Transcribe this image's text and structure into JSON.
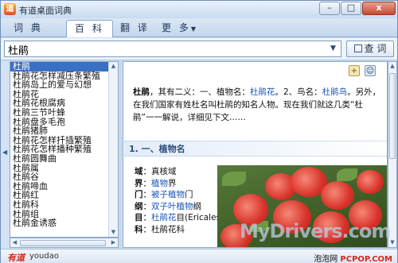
{
  "window": {
    "title": "有道桌面词典",
    "min_label": "–",
    "max_label": "□",
    "close_label": "x"
  },
  "tabs": [
    {
      "label": "词 典",
      "active": false
    },
    {
      "label": "百 科",
      "active": true
    },
    {
      "label": "翻 译",
      "active": false
    },
    {
      "label": "更 多",
      "active": false,
      "has_dropdown": true
    }
  ],
  "search": {
    "value": "杜鹃",
    "button_label": "查 词"
  },
  "word_list": [
    "杜鹃",
    "杜鹃花怎样减压条繁殖",
    "杜鹃岛上的爱与幻想",
    "杜鹃花",
    "杜鹃花根腐病",
    "杜鹃三节叶蜂",
    "杜鹃盘多毛孢",
    "杜鹃猪肺",
    "杜鹃花怎样扦插繁殖",
    "杜鹃花怎样播种繁殖",
    "杜鹃圆舞曲",
    "杜鹃属",
    "杜鹃谷",
    "杜鹃啼血",
    "杜鹃红",
    "杜鹃科",
    "杜鹃组",
    "杜鹃金诱惑"
  ],
  "content": {
    "intro_term": "杜鹃",
    "intro_a": "，其有二义：一、植物名：",
    "intro_link1": "杜鹃花",
    "intro_b": "。2、鸟名：",
    "intro_link2": "杜鹃鸟",
    "intro_c": "。另外，在我们国家",
    "intro_d": "有姓杜名叫杜鹃的知名人物。现在我们就这几类“杜鹃”一一解说，详细见下文……",
    "section_title": "1. 一、植物名",
    "taxonomy": [
      {
        "key": "域",
        "pre": "：真核域",
        "link": "",
        "post": ""
      },
      {
        "key": "界",
        "pre": "：",
        "link": "植物",
        "post": "界"
      },
      {
        "key": "门",
        "pre": "：",
        "link": "被子植物",
        "post": "门"
      },
      {
        "key": "纲",
        "pre": "：",
        "link": "双子叶植物",
        "post": "纲"
      },
      {
        "key": "目",
        "pre": "：",
        "link": "杜鹃花",
        "post": "目(Ericales)"
      },
      {
        "key": "科",
        "pre": "：杜鹃花科",
        "link": "",
        "post": ""
      }
    ]
  },
  "watermark": "MyDrivers.com",
  "footer": {
    "brand": "有道",
    "brand_sub": "youdao",
    "credit_prefix": "泡泡网 ",
    "credit_site": "PCPOP.COM"
  },
  "colors": {
    "accent_link": "#1a55b8",
    "selection": "#3b6fc4",
    "brand_red": "#d22a1c"
  }
}
